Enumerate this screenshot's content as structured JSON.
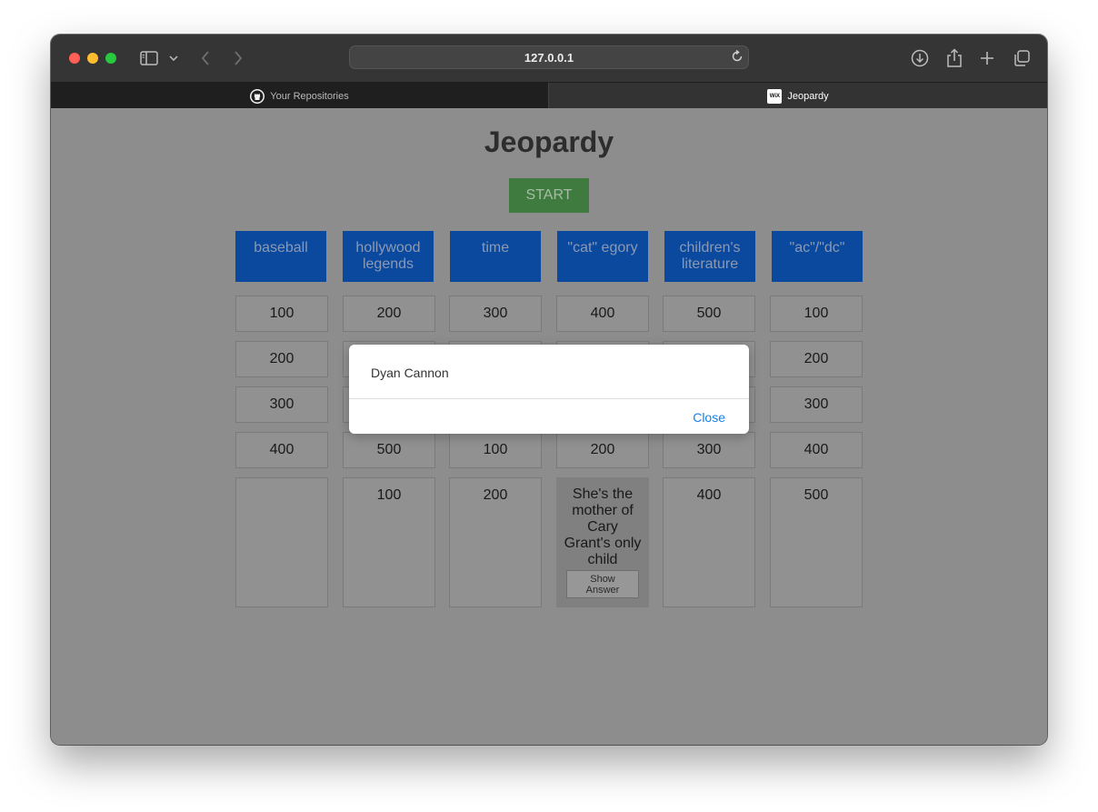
{
  "browser": {
    "url": "127.0.0.1",
    "tabs": [
      {
        "label": "Your Repositories",
        "icon": "github-icon",
        "active": false
      },
      {
        "label": "Jeopardy",
        "icon": "wix-icon",
        "favicon_text": "WiX",
        "active": true
      }
    ]
  },
  "page": {
    "title": "Jeopardy",
    "start_label": "START"
  },
  "board": {
    "categories": [
      "baseball",
      "hollywood legends",
      "time",
      "\"cat\" egory",
      "children's literature",
      "\"ac\"/\"dc\""
    ],
    "rows": [
      [
        "100",
        "200",
        "300",
        "400",
        "500",
        "100"
      ],
      [
        "200",
        "",
        "",
        "",
        "",
        "200"
      ],
      [
        "300",
        "",
        "",
        "",
        "",
        "300"
      ],
      [
        "400",
        "500",
        "100",
        "200",
        "300",
        "400"
      ],
      [
        "",
        "100",
        "200",
        "",
        "400",
        "500"
      ]
    ],
    "open_clue": {
      "text": "She's the mother of Cary Grant's only child",
      "button_label": "Show Answer"
    }
  },
  "modal": {
    "message": "Dyan Cannon",
    "close_label": "Close"
  },
  "colors": {
    "category_bg": "#0045a0",
    "start_bg": "#3a7a3a",
    "link": "#1a7ee8"
  }
}
